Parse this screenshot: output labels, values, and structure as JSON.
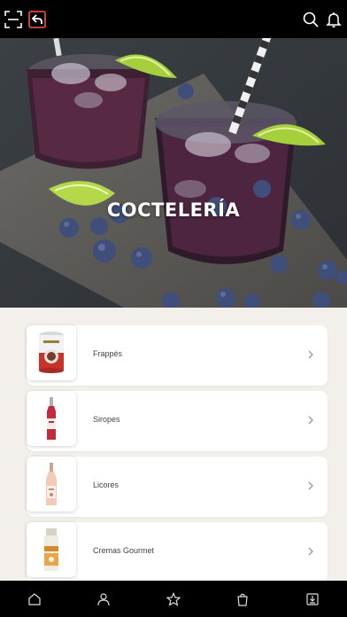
{
  "header": {
    "icons": [
      "scan-icon",
      "back-icon",
      "search-icon",
      "bell-icon"
    ],
    "accent_color": "#e4473a"
  },
  "hero": {
    "title": "COCTELERÍA"
  },
  "categories": [
    {
      "label": "Frappés",
      "image": "frappe-can"
    },
    {
      "label": "Siropes",
      "image": "syrup-bottle"
    },
    {
      "label": "Licores",
      "image": "liqueur-bottle"
    },
    {
      "label": "Cremas Gourmet",
      "image": "gourmet-cream-bottle"
    }
  ],
  "bottom_nav": {
    "icons": [
      "home-icon",
      "user-icon",
      "star-icon",
      "bag-icon",
      "download-icon"
    ]
  }
}
